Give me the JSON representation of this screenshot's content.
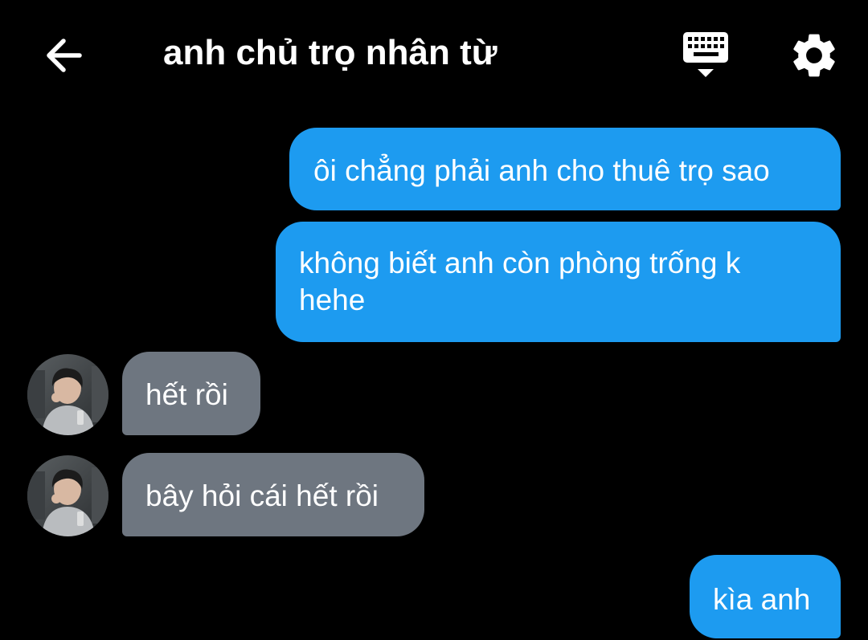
{
  "header": {
    "title": "anh chủ trọ nhân từ",
    "back_icon": "arrow-left-icon",
    "keyboard_icon": "keyboard-icon",
    "settings_icon": "gear-icon"
  },
  "messages": [
    {
      "direction": "outgoing",
      "text": "ôi chẳng phải anh cho thuê trọ sao"
    },
    {
      "direction": "outgoing",
      "text": "không biết anh còn phòng trống k hehe"
    },
    {
      "direction": "incoming",
      "text": "hết rồi",
      "avatar": "contact-avatar"
    },
    {
      "direction": "incoming",
      "text": "bây hỏi cái hết rồi",
      "avatar": "contact-avatar"
    },
    {
      "direction": "outgoing",
      "text": "kìa anh"
    }
  ],
  "colors": {
    "background": "#000000",
    "outgoing_bubble": "#1d9bf0",
    "incoming_bubble": "#6e7680",
    "text": "#ffffff"
  }
}
